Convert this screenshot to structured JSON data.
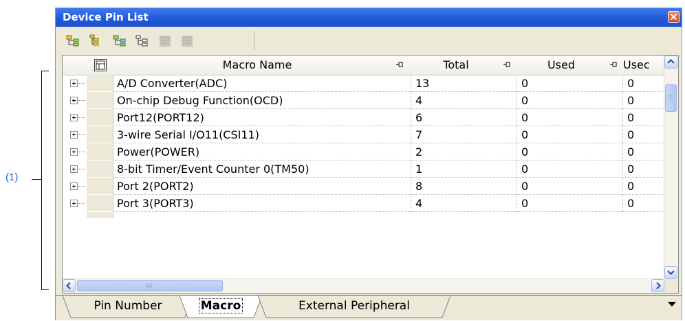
{
  "annotation": {
    "label": "(1)"
  },
  "window": {
    "title": "Device Pin List"
  },
  "toolbar": {
    "buttons": [
      {
        "name": "expand-all-icon"
      },
      {
        "name": "collapse-all-icon"
      },
      {
        "name": "expand-selection-icon"
      },
      {
        "name": "collapse-selection-icon"
      },
      {
        "name": "disabled-tree-icon-1"
      },
      {
        "name": "disabled-tree-icon-2"
      }
    ]
  },
  "grid": {
    "columns": [
      "Macro Name",
      "Total",
      "Used",
      "Usec"
    ],
    "rows": [
      {
        "name": "A/D Converter(ADC)",
        "total": "13",
        "used": "0",
        "usec": "0"
      },
      {
        "name": "On-chip Debug Function(OCD)",
        "total": "4",
        "used": "0",
        "usec": "0"
      },
      {
        "name": "Port12(PORT12)",
        "total": "6",
        "used": "0",
        "usec": "0"
      },
      {
        "name": "3-wire Serial I/O11(CSI11)",
        "total": "7",
        "used": "0",
        "usec": "0"
      },
      {
        "name": "Power(POWER)",
        "total": "2",
        "used": "0",
        "usec": "0"
      },
      {
        "name": "8-bit Timer/Event Counter 0(TM50)",
        "total": "1",
        "used": "0",
        "usec": "0"
      },
      {
        "name": "Port 2(PORT2)",
        "total": "8",
        "used": "0",
        "usec": "0"
      },
      {
        "name": "Port 3(PORT3)",
        "total": "4",
        "used": "0",
        "usec": "0"
      }
    ]
  },
  "tabs": [
    {
      "label": "Pin Number",
      "active": false
    },
    {
      "label": "Macro",
      "active": true
    },
    {
      "label": "External Peripheral",
      "active": false
    }
  ],
  "colors": {
    "titlebar": "#2a5fdc",
    "annotation": "#1a66cc",
    "window_bg": "#ece9d8"
  }
}
